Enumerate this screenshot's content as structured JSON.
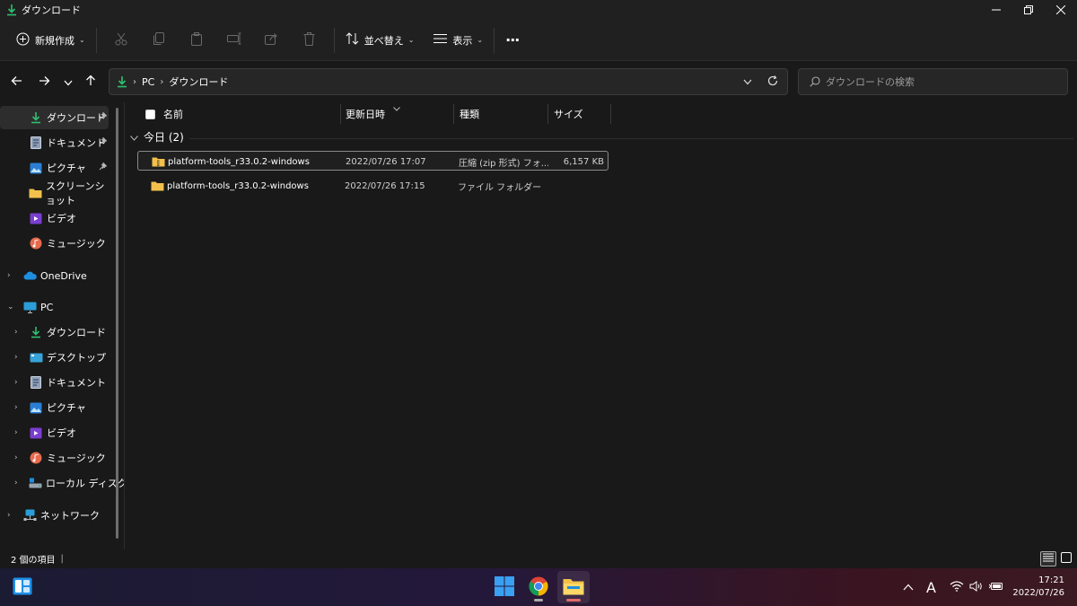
{
  "window": {
    "title": "ダウンロード"
  },
  "toolbar": {
    "new_label": "新規作成",
    "sort_label": "並べ替え",
    "view_label": "表示",
    "more_label": "···"
  },
  "address": {
    "crumbs": [
      "PC",
      "ダウンロード"
    ]
  },
  "search": {
    "placeholder": "ダウンロードの検索"
  },
  "sidebar": {
    "quick_access": [
      {
        "label": "ダウンロード",
        "icon": "download-icon",
        "pinned": true
      },
      {
        "label": "ドキュメント",
        "icon": "document-icon",
        "pinned": true
      },
      {
        "label": "ピクチャ",
        "icon": "picture-icon",
        "pinned": true
      },
      {
        "label": "スクリーンショット",
        "icon": "folder-icon",
        "pinned": false
      },
      {
        "label": "ビデオ",
        "icon": "video-icon",
        "pinned": false
      },
      {
        "label": "ミュージック",
        "icon": "music-icon",
        "pinned": false
      }
    ],
    "onedrive": "OneDrive",
    "pc": "PC",
    "pc_items": [
      {
        "label": "ダウンロード",
        "icon": "download-icon"
      },
      {
        "label": "デスクトップ",
        "icon": "desktop-icon"
      },
      {
        "label": "ドキュメント",
        "icon": "document-icon"
      },
      {
        "label": "ピクチャ",
        "icon": "picture-icon"
      },
      {
        "label": "ビデオ",
        "icon": "video-icon"
      },
      {
        "label": "ミュージック",
        "icon": "music-icon"
      },
      {
        "label": "ローカル ディスク (",
        "icon": "drive-icon"
      }
    ],
    "network": "ネットワーク"
  },
  "columns": {
    "name": "名前",
    "modified": "更新日時",
    "type": "種類",
    "size": "サイズ"
  },
  "group": {
    "label": "今日 (2)"
  },
  "files": [
    {
      "name": "platform-tools_r33.0.2-windows",
      "modified": "2022/07/26 17:07",
      "type": "圧縮 (zip 形式) フォ...",
      "size": "6,157 KB",
      "icon": "zip-folder-icon"
    },
    {
      "name": "platform-tools_r33.0.2-windows",
      "modified": "2022/07/26 17:15",
      "type": "ファイル フォルダー",
      "size": "",
      "icon": "folder-icon"
    }
  ],
  "status": {
    "count": "2 個の項目",
    "separator": "|"
  },
  "clock": {
    "time": "17:21",
    "date": "2022/07/26"
  },
  "tray": {
    "ime": "A"
  },
  "colors": {
    "accent_green": "#2fbf71",
    "folder_yellow": "#f3c14b",
    "bg": "#191919"
  }
}
